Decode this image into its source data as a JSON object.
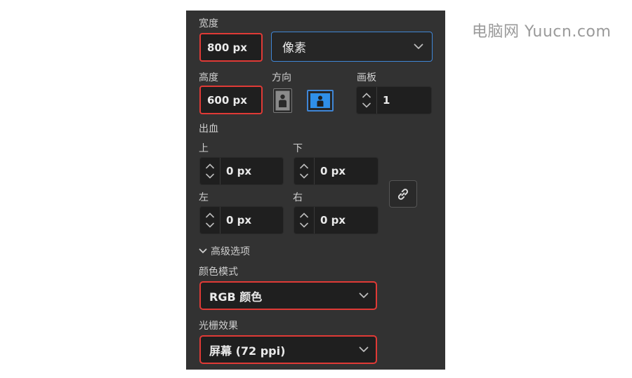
{
  "watermark": "电脑网 Yuucn.com",
  "width": {
    "label": "宽度",
    "value": "800 px"
  },
  "unit": {
    "value": "像素"
  },
  "height": {
    "label": "高度",
    "value": "600 px"
  },
  "orientation": {
    "label": "方向",
    "selected": "landscape"
  },
  "artboards": {
    "label": "画板",
    "value": "1"
  },
  "bleed": {
    "label": "出血",
    "top": {
      "label": "上",
      "value": "0 px"
    },
    "bottom": {
      "label": "下",
      "value": "0 px"
    },
    "left": {
      "label": "左",
      "value": "0 px"
    },
    "right": {
      "label": "右",
      "value": "0 px"
    }
  },
  "advanced": {
    "label": "高级选项"
  },
  "color_mode": {
    "label": "颜色模式",
    "value": "RGB 颜色"
  },
  "raster": {
    "label": "光栅效果",
    "value": "屏幕 (72 ppi)"
  },
  "colors": {
    "accent_red": "#e03a36",
    "accent_blue": "#3f86d6",
    "panel_bg": "#323232"
  }
}
